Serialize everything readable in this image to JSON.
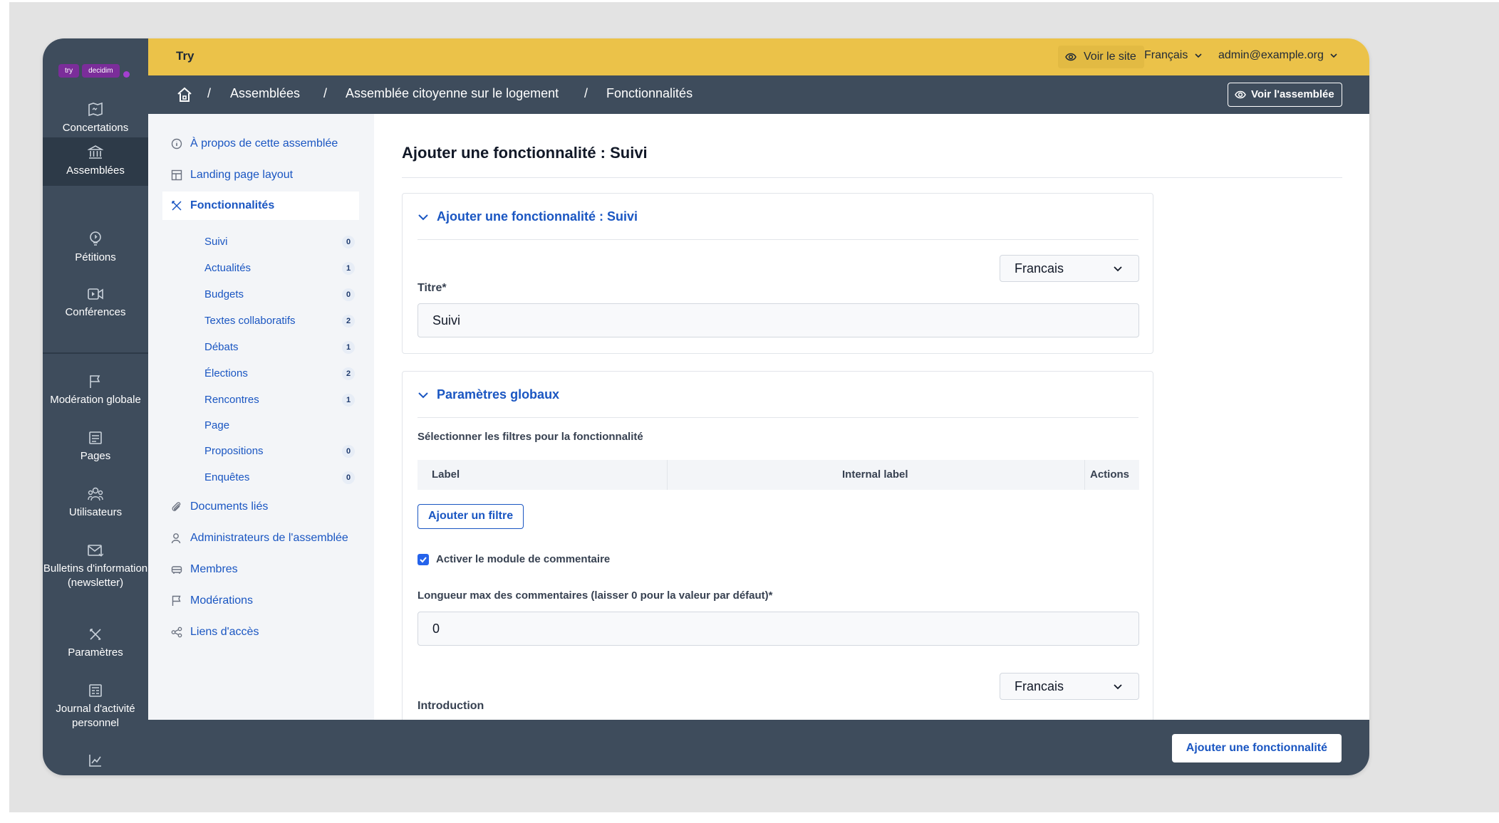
{
  "logo": {
    "part1": "try",
    "part2": "decidim"
  },
  "rail": {
    "items": [
      {
        "label": "Concertations",
        "icon": "concertations-icon"
      },
      {
        "label": "Assemblées",
        "icon": "assemblies-icon",
        "active": true
      },
      {
        "label": "Pétitions",
        "icon": "petitions-icon"
      },
      {
        "label": "Conférences",
        "icon": "conferences-icon"
      },
      {
        "label": "Modération globale",
        "icon": "flag-icon"
      },
      {
        "label": "Pages",
        "icon": "pages-icon"
      },
      {
        "label": "Utilisateurs",
        "icon": "users-icon"
      },
      {
        "label": "Bulletins d'information (newsletter)",
        "icon": "newsletter-icon"
      },
      {
        "label": "Paramètres",
        "icon": "settings-icon"
      },
      {
        "label": "Journal d'activité personnel",
        "icon": "activity-log-icon"
      }
    ]
  },
  "topbar": {
    "brand": "Try",
    "view_site": "Voir le site",
    "language": "Français",
    "user": "admin@example.org"
  },
  "breadcrumb": {
    "items": [
      "Assemblées",
      "Assemblée citoyenne sur le logement",
      "Fonctionnalités"
    ],
    "separator": "/",
    "view_assembly": "Voir l'assemblée"
  },
  "subnav": {
    "about": "À propos de cette assemblée",
    "landing": "Landing page layout",
    "features": "Fonctionnalités",
    "components": [
      {
        "label": "Suivi",
        "count": "0"
      },
      {
        "label": "Actualités",
        "count": "1"
      },
      {
        "label": "Budgets",
        "count": "0"
      },
      {
        "label": "Textes collaboratifs",
        "count": "2"
      },
      {
        "label": "Débats",
        "count": "1"
      },
      {
        "label": "Élections",
        "count": "2"
      },
      {
        "label": "Rencontres",
        "count": "1"
      },
      {
        "label": "Page",
        "count": ""
      },
      {
        "label": "Propositions",
        "count": "0"
      },
      {
        "label": "Enquêtes",
        "count": "0"
      }
    ],
    "documents": "Documents liés",
    "admins": "Administrateurs de l'assemblée",
    "members": "Membres",
    "moderations": "Modérations",
    "share": "Liens d'accès"
  },
  "main": {
    "title": "Ajouter une fonctionnalité : Suivi",
    "card1": {
      "heading": "Ajouter une fonctionnalité : Suivi",
      "lang_select": "Francais",
      "title_label": "Titre*",
      "title_value": "Suivi"
    },
    "card2": {
      "heading": "Paramètres globaux",
      "filters_label": "Sélectionner les filtres pour la fonctionnalité",
      "col_label": "Label",
      "col_internal": "Internal label",
      "col_actions": "Actions",
      "add_filter": "Ajouter un filtre",
      "comments_enabled_label": "Activer le module de commentaire",
      "comments_enabled": true,
      "max_length_label": "Longueur max des commentaires (laisser 0 pour la valeur par défaut)*",
      "max_length_value": "0",
      "intro_lang_select": "Francais",
      "intro_label": "Introduction"
    }
  },
  "footer": {
    "add_button": "Ajouter une fonctionnalité"
  }
}
